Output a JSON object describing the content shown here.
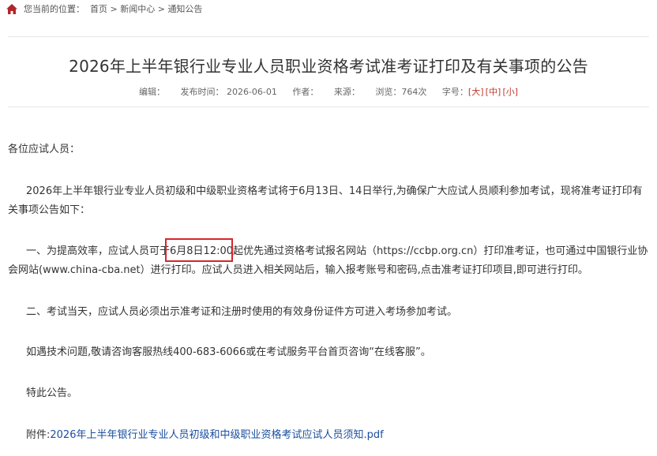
{
  "breadcrumb": {
    "prefix": "您当前的位置：",
    "items": [
      "首页",
      "新闻中心",
      "通知公告"
    ],
    "separator": ">"
  },
  "article": {
    "title": "2026年上半年银行业专业人员职业资格考试准考证打印及有关事项的公告",
    "meta": {
      "editor_label": "编辑：",
      "published_label": "发布时间：",
      "published_value": "2026-06-01",
      "author_label": "作者：",
      "source_label": "来源：",
      "views_label": "浏览：",
      "views_value": "764次",
      "fontsize_label": "字号：",
      "size_large": "大",
      "size_medium": "中",
      "size_small": "小"
    },
    "greeting": "各位应试人员：",
    "intro": "2026年上半年银行业专业人员初级和中级职业资格考试将于6月13日、14日举行,为确保广大应试人员顺利参加考试，现将准考证打印有关事项公告如下：",
    "item1": "一、为提高效率，应试人员可于6月8日12:00起优先通过资格考试报名网站（https://ccbp.org.cn）打印准考证，也可通过中国银行业协会网站(www.china-cba.net）进行打印。应试人员进入相关网站后，输入报考账号和密码,点击准考证打印项目,即可进行打印。",
    "item2": "二、考试当天，应试人员必须出示准考证和注册时使用的有效身份证件方可进入考场参加考试。",
    "support": "如遇技术问题,敬请咨询客服热线400-683-6066或在考试服务平台首页咨询“在线客服”。",
    "closing": "特此公告。",
    "attachment_label": "附件:",
    "attachment_link": "2026年上半年银行业专业人员初级和中级职业资格考试应试人员须知.pdf"
  },
  "colors": {
    "home_icon": "#b0262b",
    "highlight_box": "#d6262b",
    "size_links": "#c0392b",
    "attachment_link": "#1a4fa0"
  }
}
